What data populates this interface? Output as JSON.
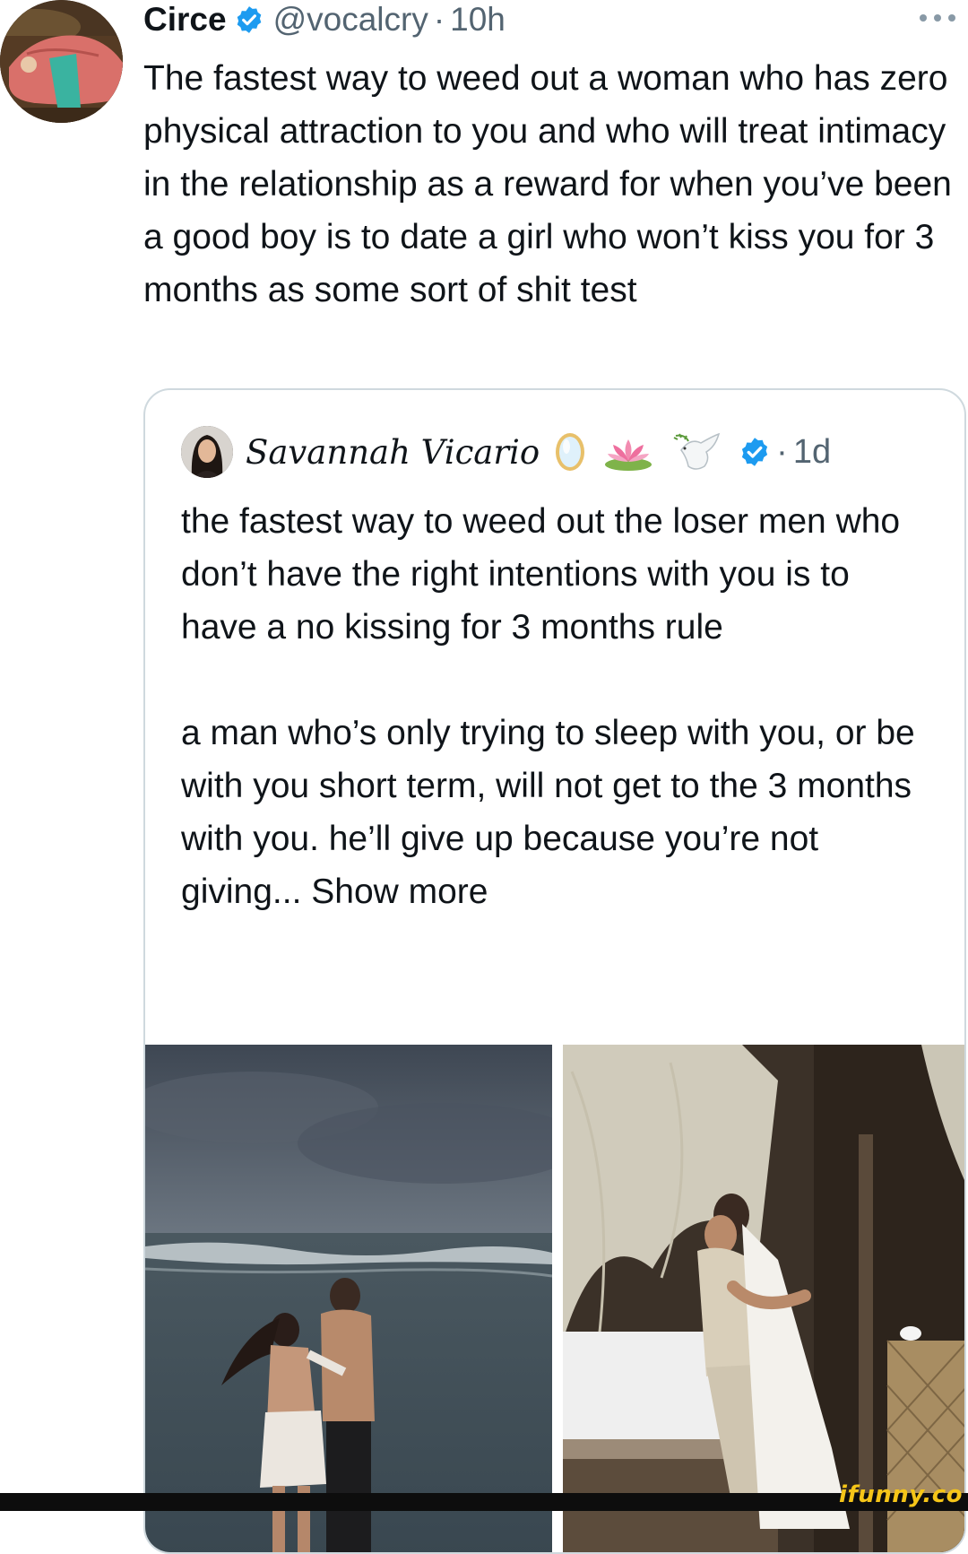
{
  "tweet": {
    "author_name": "Circe",
    "handle": "@vocalcry",
    "separator": "·",
    "time": "10h",
    "text": "The fastest way to weed out a woman who has zero physical attraction to you and who will treat intimacy in the relationship as a reward for when you’ve been a good boy is to date a girl who won’t kiss you for 3 months as some sort of shit test",
    "icons": {
      "verified": "verified-badge-icon",
      "more": "more-options-icon"
    },
    "accent_color": "#1d9bf0"
  },
  "quoted_tweet": {
    "author_name": "Savannah Vicario",
    "emojis": [
      "mirror-emoji",
      "lotus-emoji",
      "dove-emoji"
    ],
    "separator": "·",
    "time": "1d",
    "text": "the fastest way to weed out the loser men who don’t have the right intentions with you is to have a no kissing for 3 months rule\n\na man who’s only trying to sleep with you, or be with you short term, will not get to the 3 months with you. he’ll give up because you’re not giving... Show more",
    "images": [
      "beach-couple-photo",
      "canopy-bed-couple-photo"
    ]
  },
  "watermark": {
    "text": "ifunny.co",
    "color": "#f5c518"
  }
}
